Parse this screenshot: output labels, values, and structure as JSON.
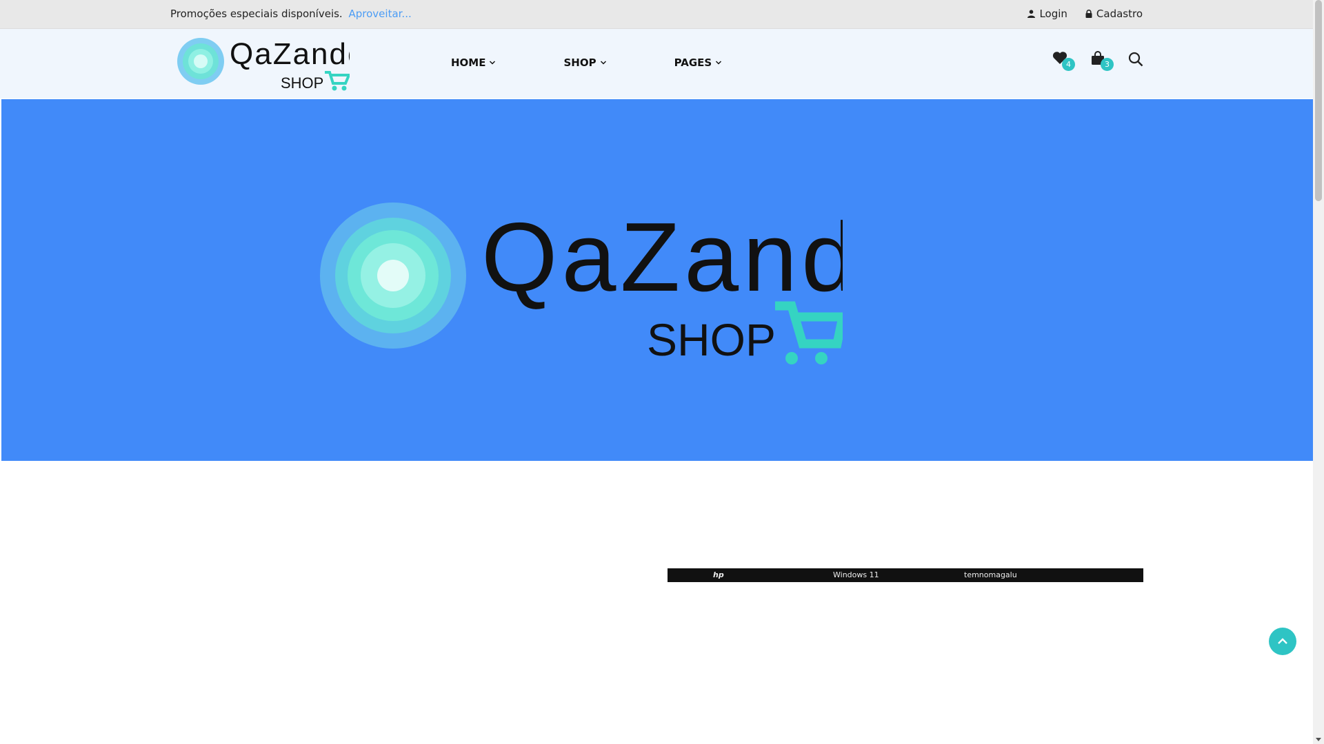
{
  "topbar": {
    "promo_text": "Promoções especiais disponíveis.",
    "promo_link": "Aproveitar...",
    "login_label": "Login",
    "signup_label": "Cadastro"
  },
  "header": {
    "logo": {
      "word": "QaZando",
      "sub": "SHOP"
    },
    "nav": [
      {
        "label": "HOME",
        "icon": "chevron-down-icon"
      },
      {
        "label": "SHOP",
        "icon": "chevron-down-icon"
      },
      {
        "label": "PAGES",
        "icon": "chevron-down-icon"
      }
    ],
    "wishlist_count": "4",
    "cart_count": "3"
  },
  "hero": {
    "logo": {
      "word": "QaZando",
      "sub": "SHOP"
    }
  },
  "product_banner": {
    "labels": [
      "hp",
      "Windows 11",
      "temnomagalu"
    ]
  },
  "colors": {
    "accent": "#2ec4c4",
    "hero_bg": "#418af9",
    "promo_link": "#4b9cf5",
    "header_bg": "#f0f6fd",
    "topbar_bg": "#e8e8e8"
  }
}
